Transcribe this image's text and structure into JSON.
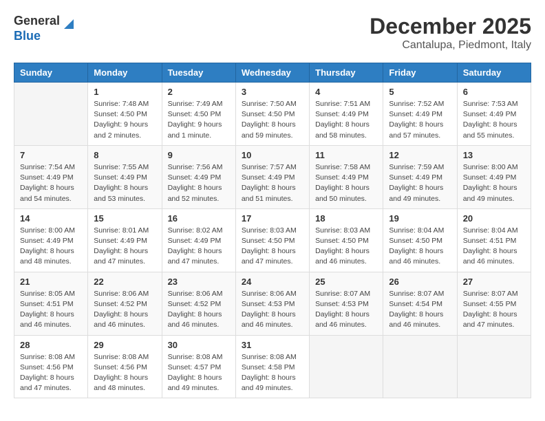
{
  "logo": {
    "general": "General",
    "blue": "Blue"
  },
  "title": "December 2025",
  "location": "Cantalupa, Piedmont, Italy",
  "days_of_week": [
    "Sunday",
    "Monday",
    "Tuesday",
    "Wednesday",
    "Thursday",
    "Friday",
    "Saturday"
  ],
  "weeks": [
    [
      {
        "day": "",
        "sunrise": "",
        "sunset": "",
        "daylight": ""
      },
      {
        "day": "1",
        "sunrise": "Sunrise: 7:48 AM",
        "sunset": "Sunset: 4:50 PM",
        "daylight": "Daylight: 9 hours and 2 minutes."
      },
      {
        "day": "2",
        "sunrise": "Sunrise: 7:49 AM",
        "sunset": "Sunset: 4:50 PM",
        "daylight": "Daylight: 9 hours and 1 minute."
      },
      {
        "day": "3",
        "sunrise": "Sunrise: 7:50 AM",
        "sunset": "Sunset: 4:50 PM",
        "daylight": "Daylight: 8 hours and 59 minutes."
      },
      {
        "day": "4",
        "sunrise": "Sunrise: 7:51 AM",
        "sunset": "Sunset: 4:49 PM",
        "daylight": "Daylight: 8 hours and 58 minutes."
      },
      {
        "day": "5",
        "sunrise": "Sunrise: 7:52 AM",
        "sunset": "Sunset: 4:49 PM",
        "daylight": "Daylight: 8 hours and 57 minutes."
      },
      {
        "day": "6",
        "sunrise": "Sunrise: 7:53 AM",
        "sunset": "Sunset: 4:49 PM",
        "daylight": "Daylight: 8 hours and 55 minutes."
      }
    ],
    [
      {
        "day": "7",
        "sunrise": "Sunrise: 7:54 AM",
        "sunset": "Sunset: 4:49 PM",
        "daylight": "Daylight: 8 hours and 54 minutes."
      },
      {
        "day": "8",
        "sunrise": "Sunrise: 7:55 AM",
        "sunset": "Sunset: 4:49 PM",
        "daylight": "Daylight: 8 hours and 53 minutes."
      },
      {
        "day": "9",
        "sunrise": "Sunrise: 7:56 AM",
        "sunset": "Sunset: 4:49 PM",
        "daylight": "Daylight: 8 hours and 52 minutes."
      },
      {
        "day": "10",
        "sunrise": "Sunrise: 7:57 AM",
        "sunset": "Sunset: 4:49 PM",
        "daylight": "Daylight: 8 hours and 51 minutes."
      },
      {
        "day": "11",
        "sunrise": "Sunrise: 7:58 AM",
        "sunset": "Sunset: 4:49 PM",
        "daylight": "Daylight: 8 hours and 50 minutes."
      },
      {
        "day": "12",
        "sunrise": "Sunrise: 7:59 AM",
        "sunset": "Sunset: 4:49 PM",
        "daylight": "Daylight: 8 hours and 49 minutes."
      },
      {
        "day": "13",
        "sunrise": "Sunrise: 8:00 AM",
        "sunset": "Sunset: 4:49 PM",
        "daylight": "Daylight: 8 hours and 49 minutes."
      }
    ],
    [
      {
        "day": "14",
        "sunrise": "Sunrise: 8:00 AM",
        "sunset": "Sunset: 4:49 PM",
        "daylight": "Daylight: 8 hours and 48 minutes."
      },
      {
        "day": "15",
        "sunrise": "Sunrise: 8:01 AM",
        "sunset": "Sunset: 4:49 PM",
        "daylight": "Daylight: 8 hours and 47 minutes."
      },
      {
        "day": "16",
        "sunrise": "Sunrise: 8:02 AM",
        "sunset": "Sunset: 4:49 PM",
        "daylight": "Daylight: 8 hours and 47 minutes."
      },
      {
        "day": "17",
        "sunrise": "Sunrise: 8:03 AM",
        "sunset": "Sunset: 4:50 PM",
        "daylight": "Daylight: 8 hours and 47 minutes."
      },
      {
        "day": "18",
        "sunrise": "Sunrise: 8:03 AM",
        "sunset": "Sunset: 4:50 PM",
        "daylight": "Daylight: 8 hours and 46 minutes."
      },
      {
        "day": "19",
        "sunrise": "Sunrise: 8:04 AM",
        "sunset": "Sunset: 4:50 PM",
        "daylight": "Daylight: 8 hours and 46 minutes."
      },
      {
        "day": "20",
        "sunrise": "Sunrise: 8:04 AM",
        "sunset": "Sunset: 4:51 PM",
        "daylight": "Daylight: 8 hours and 46 minutes."
      }
    ],
    [
      {
        "day": "21",
        "sunrise": "Sunrise: 8:05 AM",
        "sunset": "Sunset: 4:51 PM",
        "daylight": "Daylight: 8 hours and 46 minutes."
      },
      {
        "day": "22",
        "sunrise": "Sunrise: 8:06 AM",
        "sunset": "Sunset: 4:52 PM",
        "daylight": "Daylight: 8 hours and 46 minutes."
      },
      {
        "day": "23",
        "sunrise": "Sunrise: 8:06 AM",
        "sunset": "Sunset: 4:52 PM",
        "daylight": "Daylight: 8 hours and 46 minutes."
      },
      {
        "day": "24",
        "sunrise": "Sunrise: 8:06 AM",
        "sunset": "Sunset: 4:53 PM",
        "daylight": "Daylight: 8 hours and 46 minutes."
      },
      {
        "day": "25",
        "sunrise": "Sunrise: 8:07 AM",
        "sunset": "Sunset: 4:53 PM",
        "daylight": "Daylight: 8 hours and 46 minutes."
      },
      {
        "day": "26",
        "sunrise": "Sunrise: 8:07 AM",
        "sunset": "Sunset: 4:54 PM",
        "daylight": "Daylight: 8 hours and 46 minutes."
      },
      {
        "day": "27",
        "sunrise": "Sunrise: 8:07 AM",
        "sunset": "Sunset: 4:55 PM",
        "daylight": "Daylight: 8 hours and 47 minutes."
      }
    ],
    [
      {
        "day": "28",
        "sunrise": "Sunrise: 8:08 AM",
        "sunset": "Sunset: 4:56 PM",
        "daylight": "Daylight: 8 hours and 47 minutes."
      },
      {
        "day": "29",
        "sunrise": "Sunrise: 8:08 AM",
        "sunset": "Sunset: 4:56 PM",
        "daylight": "Daylight: 8 hours and 48 minutes."
      },
      {
        "day": "30",
        "sunrise": "Sunrise: 8:08 AM",
        "sunset": "Sunset: 4:57 PM",
        "daylight": "Daylight: 8 hours and 49 minutes."
      },
      {
        "day": "31",
        "sunrise": "Sunrise: 8:08 AM",
        "sunset": "Sunset: 4:58 PM",
        "daylight": "Daylight: 8 hours and 49 minutes."
      },
      {
        "day": "",
        "sunrise": "",
        "sunset": "",
        "daylight": ""
      },
      {
        "day": "",
        "sunrise": "",
        "sunset": "",
        "daylight": ""
      },
      {
        "day": "",
        "sunrise": "",
        "sunset": "",
        "daylight": ""
      }
    ]
  ]
}
